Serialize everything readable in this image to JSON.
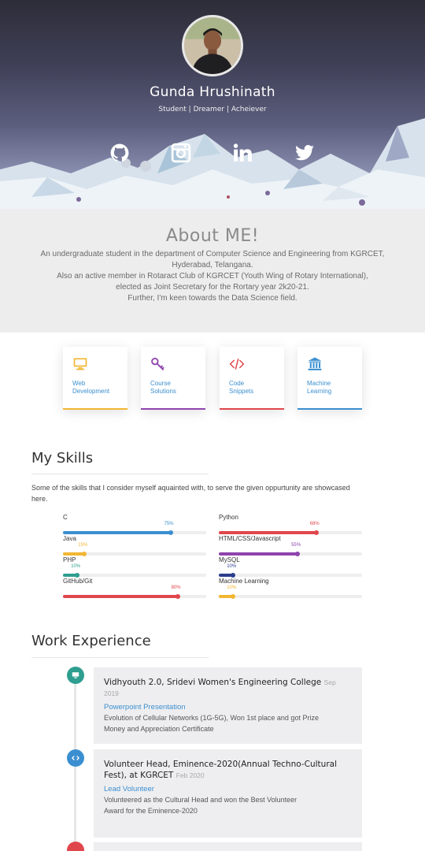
{
  "profile": {
    "name": "Gunda Hrushinath",
    "tagline": "Student | Dreamer | Acheiever"
  },
  "social": [
    {
      "icon": "github-icon"
    },
    {
      "icon": "instagram-icon"
    },
    {
      "icon": "linkedin-icon"
    },
    {
      "icon": "twitter-icon"
    }
  ],
  "about": {
    "title": "About ME!",
    "lines": [
      "An undergraduate student in the department of Computer Science and Engineering from KGRCET,",
      "Hyderabad, Telangana.",
      "Also an active member in Rotaract Club of KGRCET (Youth Wing of Rotary International),",
      "elected as Joint Secretary for the Rortary year 2k20-21.",
      "Further, I'm keen towards the Data Science field."
    ]
  },
  "services": [
    {
      "line1": "Web",
      "line2": "Development",
      "icon": "monitor-icon",
      "color": "#f2b632"
    },
    {
      "line1": "Course",
      "line2": "Solutions",
      "icon": "key-icon",
      "color": "#8e44ad"
    },
    {
      "line1": "Code",
      "line2": "Snippets",
      "icon": "code-icon",
      "color": "#e0474c"
    },
    {
      "line1": "Machine",
      "line2": "Learning",
      "icon": "bank-icon",
      "color": "#3b8fd0"
    }
  ],
  "skills": {
    "title": "My Skills",
    "description_line1": "Some of the skills that I consider myself aquainted with, to serve the given oppurtunity are showcased",
    "description_line2": "here.",
    "items": [
      {
        "name": "C",
        "percent": 75,
        "percent_label": "75%",
        "color": "#3b8fd0"
      },
      {
        "name": "Java",
        "percent": 15,
        "percent_label": "15%",
        "color": "#f2b632"
      },
      {
        "name": "PHP",
        "percent": 10,
        "percent_label": "10%",
        "color": "#2e9e8f"
      },
      {
        "name": "GitHub/Git",
        "percent": 80,
        "percent_label": "80%",
        "color": "#e0474c"
      },
      {
        "name": "Python",
        "percent": 68,
        "percent_label": "68%",
        "color": "#e0474c"
      },
      {
        "name": "HTML/CSS/Javascript",
        "percent": 55,
        "percent_label": "55%",
        "color": "#8e44ad"
      },
      {
        "name": "MySQL",
        "percent": 10,
        "percent_label": "10%",
        "color": "#2c3e8c"
      },
      {
        "name": "Machine Learning",
        "percent": 10,
        "percent_label": "10%",
        "color": "#f2b632"
      }
    ]
  },
  "work": {
    "title": "Work Experience",
    "items": [
      {
        "title": "Vidhyouth 2.0, Sridevi Women's Engineering College",
        "date": "Sep 2019",
        "role": "Powerpoint Presentation",
        "desc_line1": "Evolution of Cellular Networks (1G-5G), Won 1st place and got Prize",
        "desc_line2": "Money and Appreciation Certificate",
        "icon": "monitor-icon",
        "color": "#2e9e8f"
      },
      {
        "title_line1": "Volunteer Head, Eminence-2020(Annual Techno-Cultural",
        "title_line2": "Fest), at KGRCET",
        "date": "Feb 2020",
        "role": "Lead Volunteer",
        "desc_line1": "Volunteered as the Cultural Head and won the Best Volunteer",
        "desc_line2": "Award for the Eminence-2020",
        "icon": "code-icon",
        "color": "#3b8fd0"
      }
    ],
    "third_dot_color": "#e0474c"
  }
}
